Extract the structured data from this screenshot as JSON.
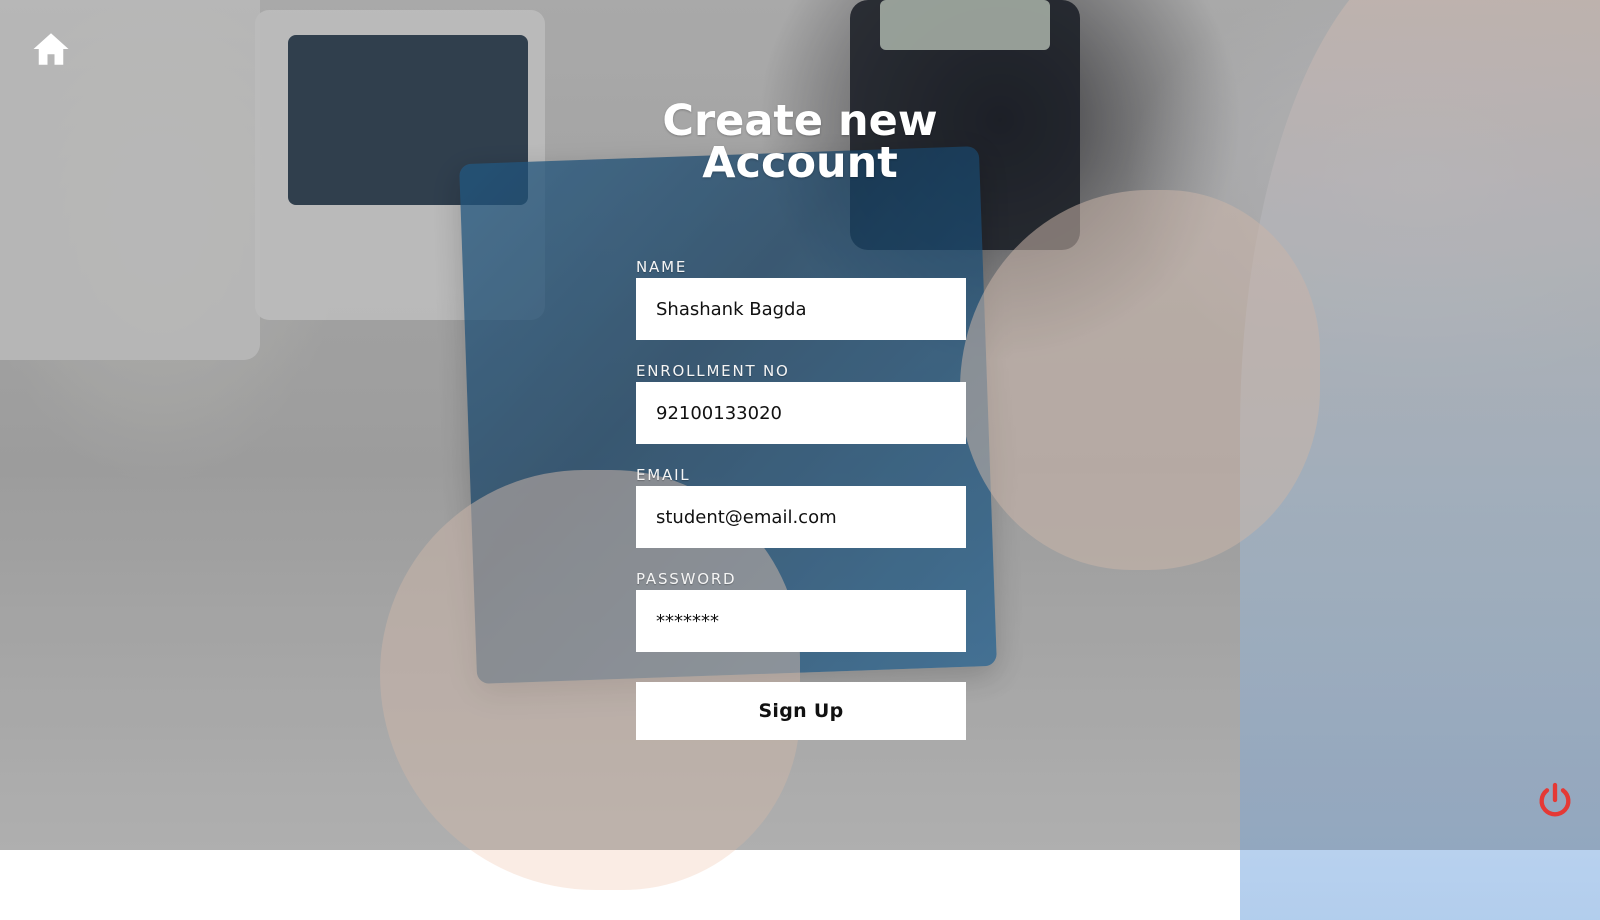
{
  "page": {
    "title_line1": "Create new",
    "title_line2": "Account"
  },
  "form": {
    "name": {
      "label": "NAME",
      "value": "Shashank Bagda"
    },
    "enrollment": {
      "label": "ENROLLMENT NO",
      "value": "92100133020"
    },
    "email": {
      "label": "EMAIL",
      "value": "student@email.com"
    },
    "password": {
      "label": "PASSWORD",
      "value": "*******"
    },
    "submit_label": "Sign Up"
  },
  "icons": {
    "home": "home-icon",
    "power": "power-icon"
  },
  "colors": {
    "title": "#ffffff",
    "field_bg": "#ffffff",
    "power_icon": "#e53935"
  }
}
